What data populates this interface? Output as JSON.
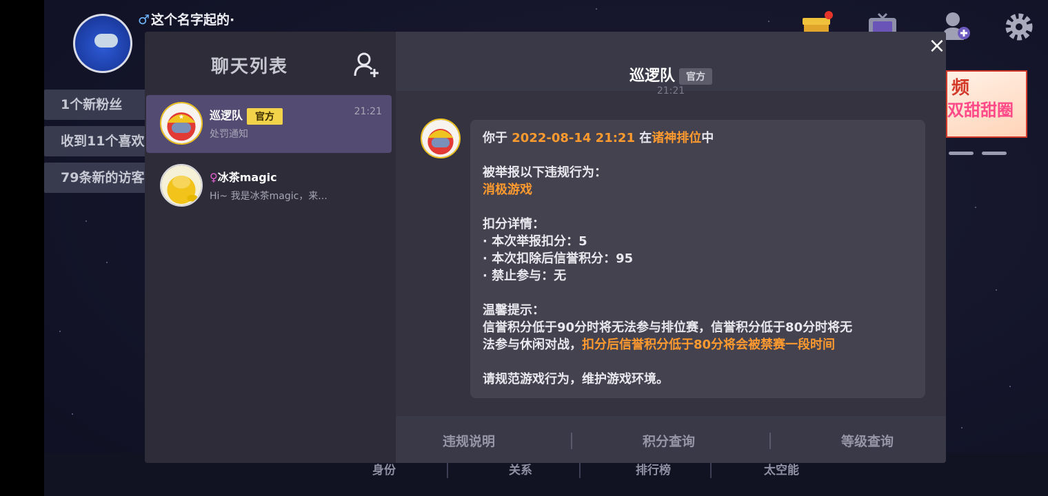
{
  "profile": {
    "gender_symbol": "♂",
    "name": "这个名字起的·"
  },
  "notices": [
    "1个新粉丝",
    "收到11个喜欢",
    "79条新的访客"
  ],
  "banner": {
    "line1": "频",
    "line2": "双甜甜圈"
  },
  "bottom_nav": [
    "身份",
    "关系",
    "排行榜",
    "太空能"
  ],
  "chat_list": {
    "title": "聊天列表",
    "items": [
      {
        "name": "巡逻队",
        "badge": "官方",
        "preview": "处罚通知",
        "time": "21:21"
      },
      {
        "name": "冰茶magic",
        "preview": "Hi~ 我是冰茶magic，来..."
      }
    ]
  },
  "chat": {
    "title": "巡逻队",
    "badge": "官方",
    "timestamp": "21:21",
    "message": {
      "l1_pre": "你于 ",
      "l1_date": "2022-08-14 21:21",
      "l1_mid": " 在",
      "l1_mode": "诸神排位",
      "l1_post": "中",
      "reported": "被举报以下违规行为：",
      "violation": "消极游戏",
      "deduct_title": "扣分详情：",
      "deduct_items": [
        "· 本次举报扣分：5",
        "· 本次扣除后信誉积分：95",
        "· 禁止参与：无"
      ],
      "tip_title": "温馨提示：",
      "tip_line1": "信誉积分低于90分时将无法参与排位赛，信誉积分低于80分时将无",
      "tip_line2_pre": "法参与休闲对战，",
      "tip_line2_highlight": "扣分后信誉积分低于80分将会被禁赛一段时间",
      "closing": "请规范游戏行为，维护游戏环境。"
    }
  },
  "footer": {
    "btn1": "违规说明",
    "btn2": "积分查询",
    "btn3": "等级查询"
  },
  "close_label": "×",
  "colors": {
    "highlight": "#ff9a2f",
    "badge": "#f3d34a",
    "active_item": "#534b71"
  }
}
